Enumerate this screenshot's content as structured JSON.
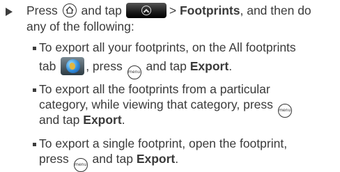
{
  "step": {
    "press_1": "Press",
    "and_tap": "and tap",
    "gt_target": "> ",
    "target": "Footprints",
    "then": ", and then do",
    "line2": "any of the following:"
  },
  "bullets": [
    {
      "line1": "To export all your footprints, on the All footprints",
      "tab": "tab",
      "press": ", press",
      "and_tap": "and tap",
      "action": "Export",
      "end": "."
    },
    {
      "line1": "To export all the footprints from a particular",
      "line2": "category, while viewing that category, press",
      "and_tap": "and tap",
      "action": "Export",
      "end": "."
    },
    {
      "line1": "To export a single footprint, open the footprint,",
      "press": "press",
      "and_tap": "and tap",
      "action": "Export",
      "end": "."
    }
  ],
  "icons": {
    "home_key": "home-key-icon",
    "menu_key": "menu-key-icon",
    "menu_key_text": "menu",
    "app_button": "all-apps-button-icon",
    "globe": "all-footprints-tab-icon"
  }
}
